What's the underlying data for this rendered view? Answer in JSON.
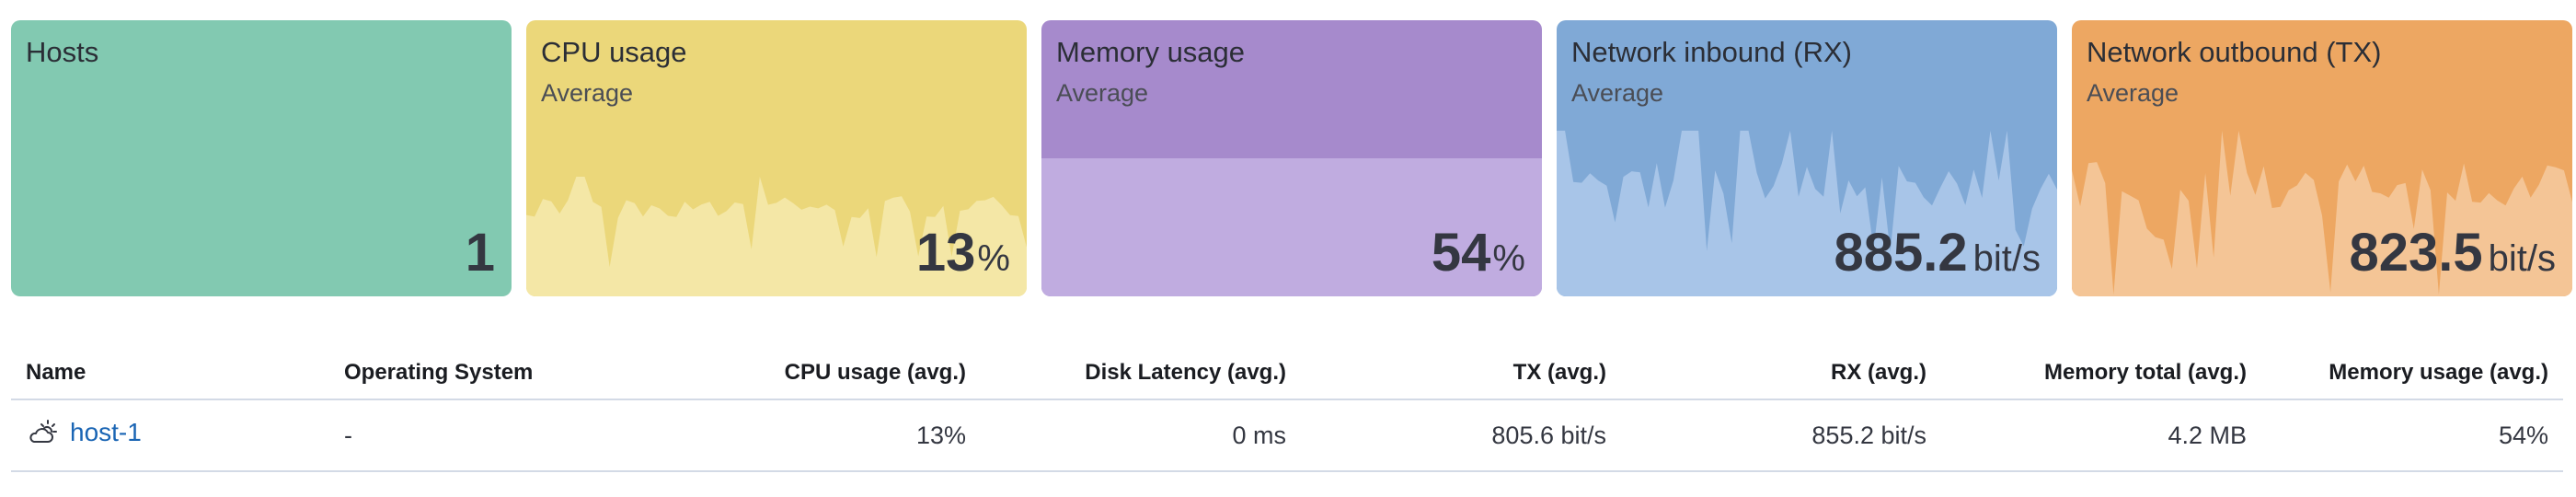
{
  "tiles": [
    {
      "title": "Hosts",
      "subtitle": "",
      "value": "1",
      "unit": "",
      "bg": "#82c9b1",
      "fill": "#82c9b1"
    },
    {
      "title": "CPU usage",
      "subtitle": "Average",
      "value": "13",
      "unit": "%",
      "bg": "#ebd77a",
      "fill": "#f4e7a6"
    },
    {
      "title": "Memory usage",
      "subtitle": "Average",
      "value": "54",
      "unit": "%",
      "bg": "#a68acc",
      "fill": "#c0ace0"
    },
    {
      "title": "Network inbound (RX)",
      "subtitle": "Average",
      "value": "885.2",
      "unit": "bit/s",
      "bg": "#80a9d6",
      "fill": "#a8c5e8"
    },
    {
      "title": "Network outbound (TX)",
      "subtitle": "Average",
      "value": "823.5",
      "unit": "bit/s",
      "bg": "#eda762",
      "fill": "#f4c596"
    }
  ],
  "table": {
    "headers": {
      "name": "Name",
      "os": "Operating System",
      "cpu": "CPU usage (avg.)",
      "disk": "Disk Latency (avg.)",
      "tx": "TX (avg.)",
      "rx": "RX (avg.)",
      "mem_total": "Memory total (avg.)",
      "mem_usage": "Memory usage (avg.)"
    },
    "rows": [
      {
        "name": "host-1",
        "icon": "cloud-sun-icon",
        "os": "-",
        "cpu": "13%",
        "disk": "0 ms",
        "tx": "805.6 bit/s",
        "rx": "855.2 bit/s",
        "mem_total": "4.2 MB",
        "mem_usage": "54%"
      }
    ]
  }
}
